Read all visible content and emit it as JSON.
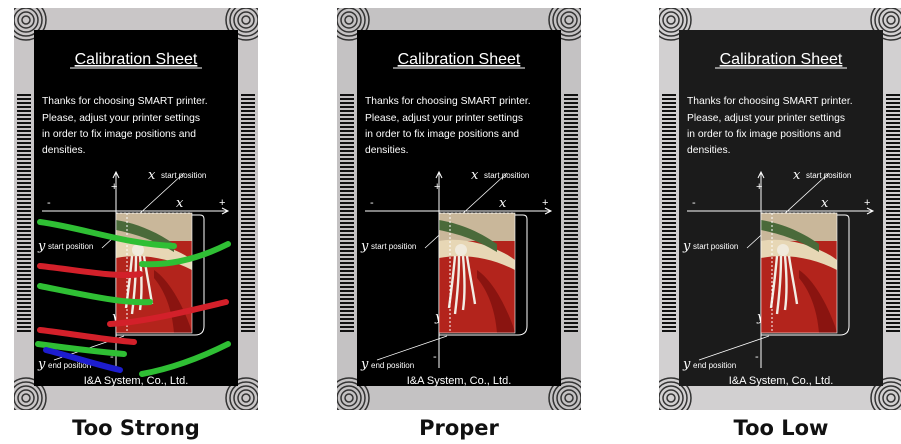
{
  "sheet": {
    "title": "Calibration Sheet",
    "paragraph_1": "Thanks for choosing SMART printer.",
    "paragraph_2_line_1": "Please, adjust your printer settings",
    "paragraph_2_line_2": "in order to fix image positions and",
    "paragraph_2_line_3": "densities.",
    "x_start_label": "start position",
    "y_start_label": "start position",
    "y_end_label": "end position",
    "axis_x_letter": "x",
    "axis_y_letter": "y",
    "plus_sign": "+",
    "minus_sign": "-",
    "footer": "I&A System, Co., Ltd."
  },
  "panels": [
    {
      "caption": "Too Strong",
      "paper_color": "#c9c6c7",
      "sheet_color": "#000000",
      "streaks": true
    },
    {
      "caption": "Proper",
      "paper_color": "#c4c2c3",
      "sheet_color": "#000000",
      "streaks": false
    },
    {
      "caption": "Too Low",
      "paper_color": "#d2d0d1",
      "sheet_color": "#1b1b1b",
      "streaks": false
    }
  ]
}
